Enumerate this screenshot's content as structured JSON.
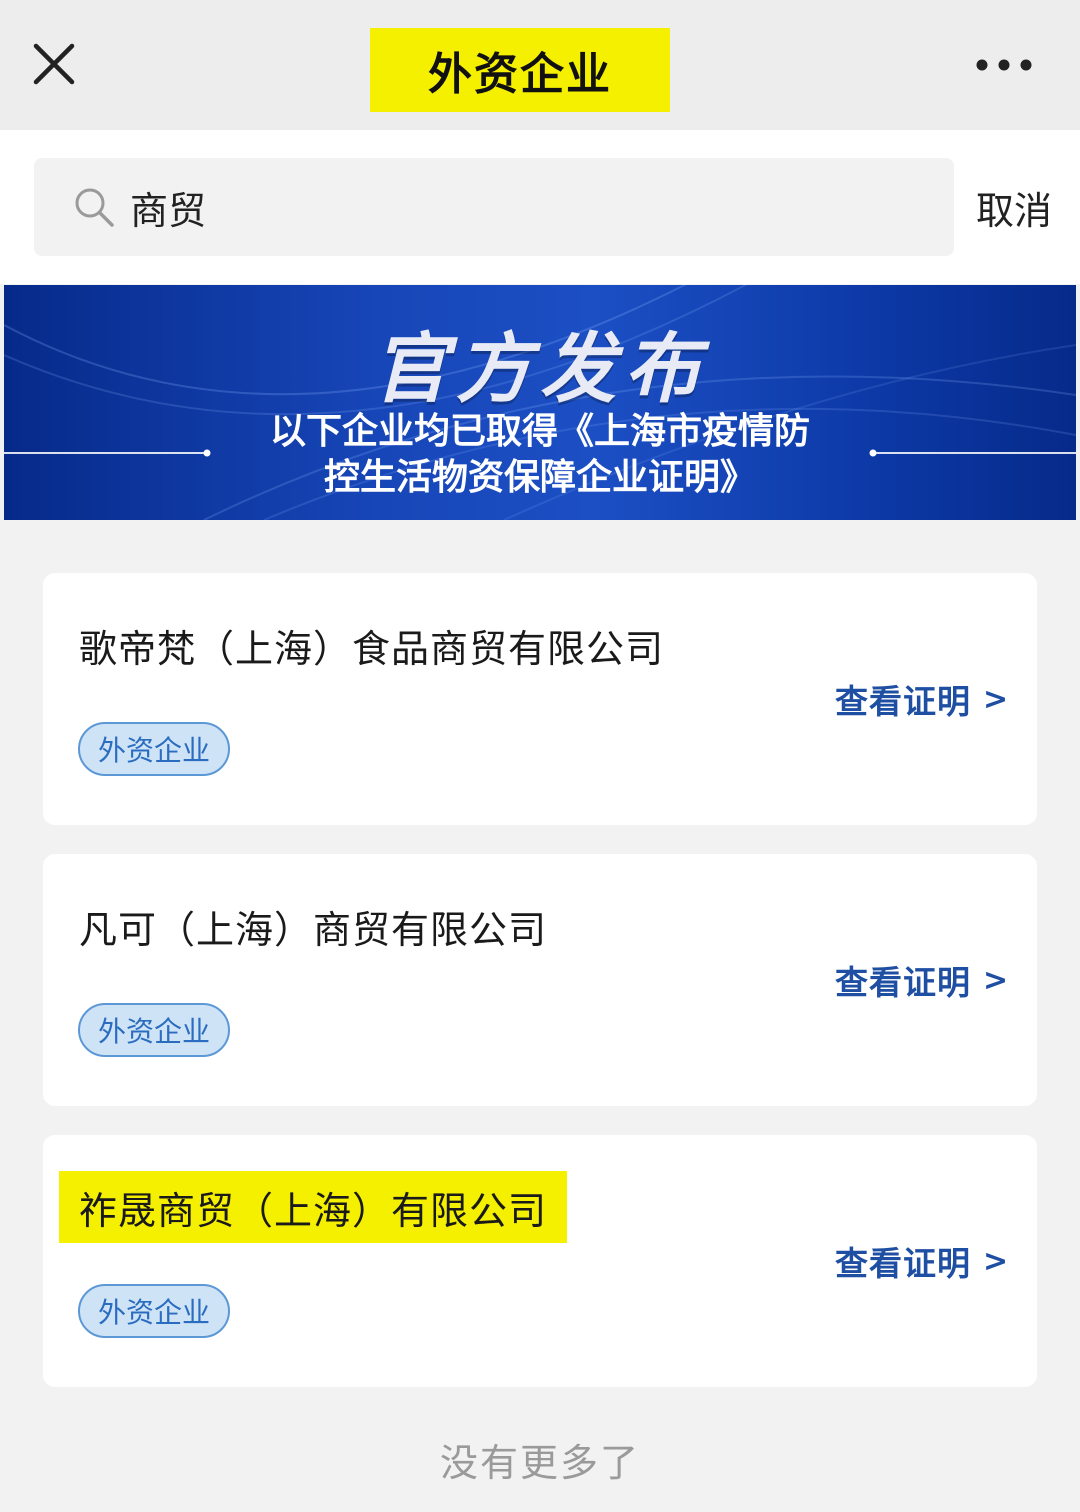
{
  "nav": {
    "title": "外资企业",
    "close_icon": "close-icon",
    "more_icon": "more-dots-icon"
  },
  "search": {
    "value": "商贸",
    "cancel_label": "取消"
  },
  "banner": {
    "headline": "官方发布",
    "subtitle_line1": "以下企业均已取得《上海市疫情防",
    "subtitle_line2": "控生活物资保障企业证明》"
  },
  "results": [
    {
      "name": "歌帝梵（上海）食品商贸有限公司",
      "tag": "外资企业",
      "link_label": "查看证明",
      "highlighted": false
    },
    {
      "name": "凡可（上海）商贸有限公司",
      "tag": "外资企业",
      "link_label": "查看证明",
      "highlighted": false
    },
    {
      "name": "祚晟商贸（上海）有限公司",
      "tag": "外资企业",
      "link_label": "查看证明",
      "highlighted": true
    }
  ],
  "footer": {
    "no_more": "没有更多了"
  },
  "colors": {
    "highlight": "#f5f000",
    "link": "#1f4fa3",
    "tag_bg": "#cfe3f7",
    "tag_border": "#5c97d6",
    "banner_blue": "#1746b8"
  }
}
